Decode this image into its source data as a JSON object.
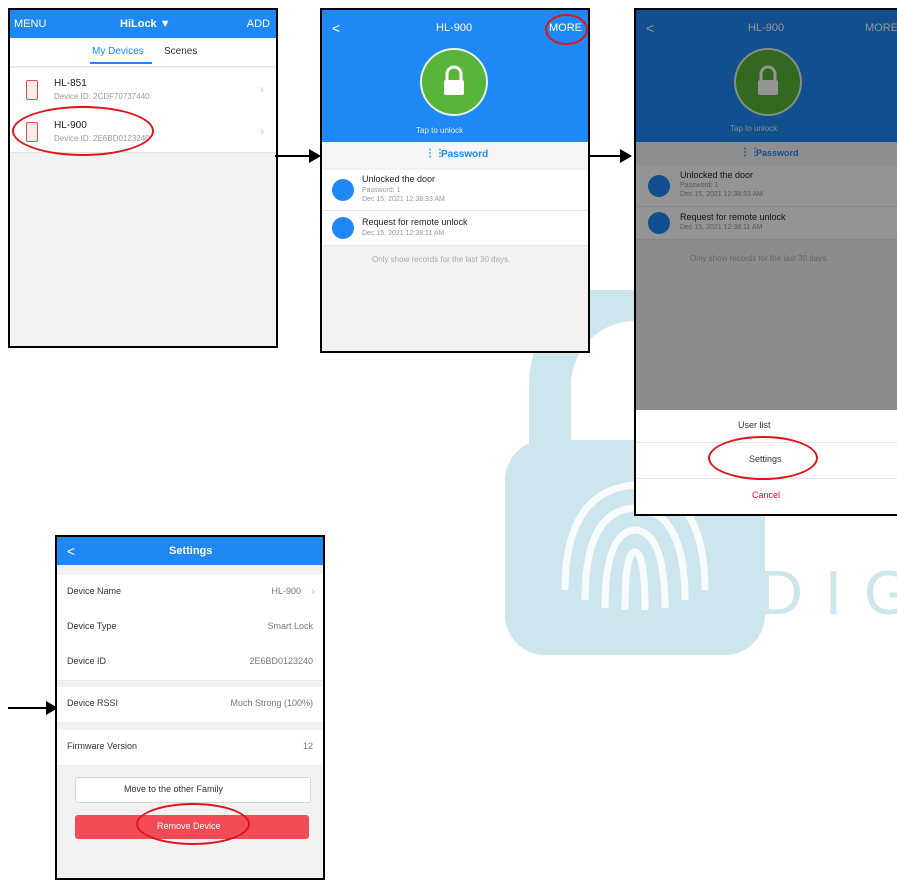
{
  "colors": {
    "header_blue": "#1e88f5",
    "lock_green": "#58b43a",
    "annotation_red": "#e0151b",
    "remove_red": "#f24b55",
    "watermark": "#cde6ee"
  },
  "watermark": {
    "text": "DIG"
  },
  "screen1": {
    "menu": "MENU",
    "title": "HiLock",
    "add": "ADD",
    "tabs": [
      "My Devices",
      "Scenes"
    ],
    "devices": [
      {
        "name": "HL-851",
        "id": "Device ID: 2CDF70737440"
      },
      {
        "name": "HL-900",
        "id": "Device ID: 2E6BD0123240"
      }
    ]
  },
  "screen2": {
    "back": "<",
    "title": "HL-900",
    "more": "MORE",
    "tap_label": "Tap to unlock",
    "mode_label": "Password",
    "records": [
      {
        "title": "Unlocked the door",
        "line1": "Password: 1",
        "line2": "Dec 15, 2021 12:38:33 AM"
      },
      {
        "title": "Request for remote unlock",
        "line1": "Dec 15, 2021 12:38:11 AM",
        "line2": ""
      }
    ],
    "footer": "Only show records for the last 30 days."
  },
  "screen3": {
    "back": "<",
    "title": "HL-900",
    "more": "MORE",
    "tap_label": "Tap to unlock",
    "mode_label": "Password",
    "records": [
      {
        "title": "Unlocked the door",
        "line1": "Password: 1",
        "line2": "Dec 15, 2021 12:38:33 AM"
      },
      {
        "title": "Request for remote unlock",
        "line1": "Dec 15, 2021 12:38:11 AM"
      }
    ],
    "footer": "Only show records for the last 30 days.",
    "sheet": {
      "user_list": "User list",
      "settings": "Settings",
      "cancel": "Cancel"
    }
  },
  "screen4": {
    "back": "<",
    "title": "Settings",
    "rows": [
      {
        "label": "Device Name",
        "value": "HL-900"
      },
      {
        "label": "Device Type",
        "value": "Smart Lock"
      },
      {
        "label": "Device ID",
        "value": "2E6BD0123240"
      },
      {
        "label": "Device RSSI",
        "value": "Much Strong (100%)"
      },
      {
        "label": "Firmware Version",
        "value": "12"
      }
    ],
    "move_btn": "Move to the other Family",
    "remove_btn": "Remove Device"
  }
}
